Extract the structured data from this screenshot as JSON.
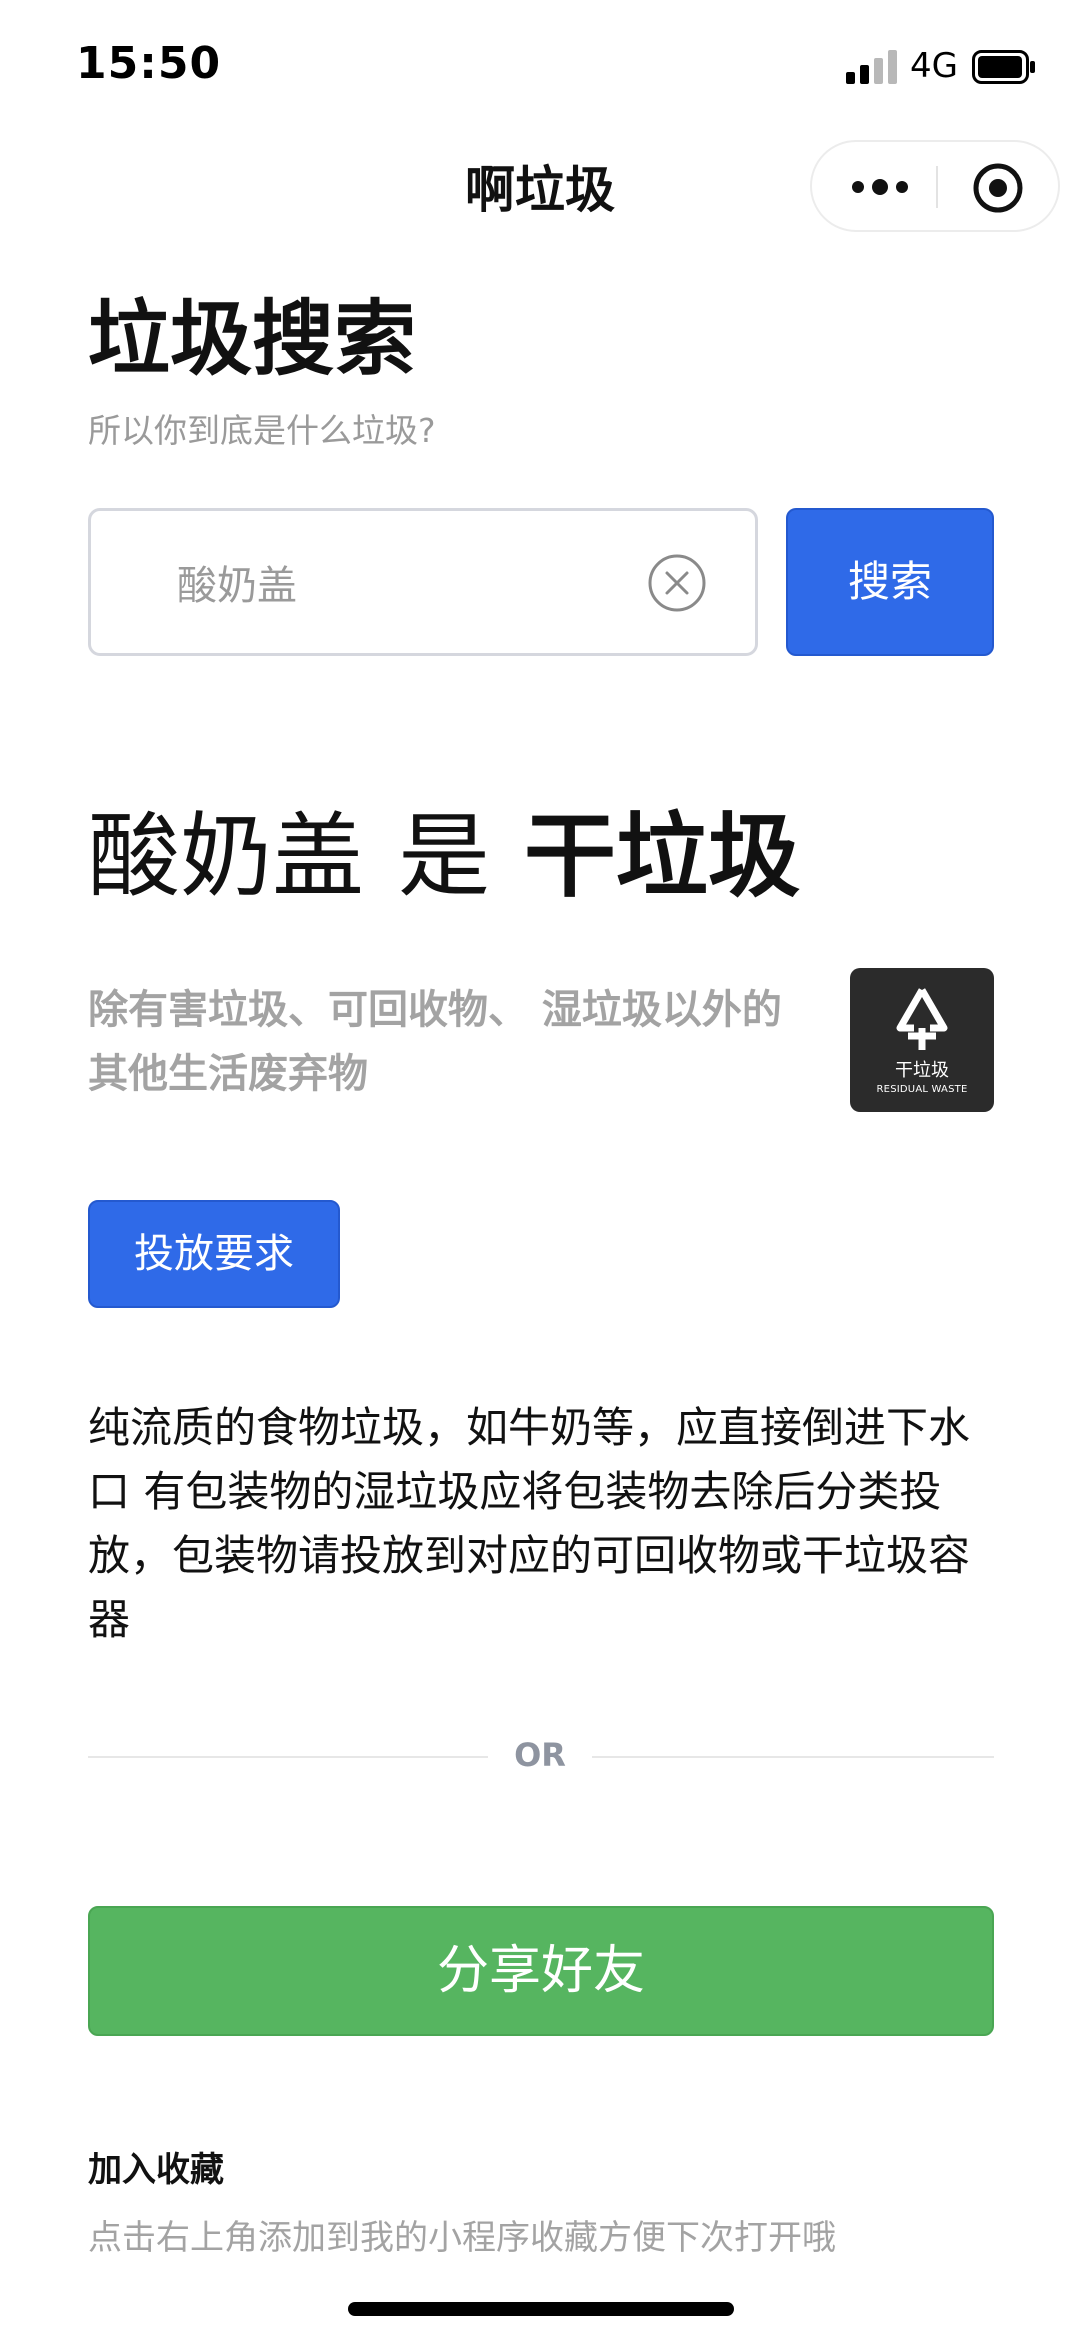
{
  "status_bar": {
    "time": "15:50",
    "network": "4G",
    "signal_icon": "signal-bars-icon",
    "battery_icon": "battery-icon"
  },
  "nav": {
    "title": "啊垃圾",
    "more_icon": "more-dots-icon",
    "close_icon": "record-target-icon"
  },
  "header": {
    "title": "垃圾搜索",
    "subtitle": "所以你到底是什么垃圾?"
  },
  "search": {
    "value": "酸奶盖",
    "placeholder": "",
    "button_label": "搜索",
    "clear_icon": "clear-circle-icon"
  },
  "result": {
    "item": "酸奶盖",
    "verb": "是",
    "category": "干垃圾",
    "description": "除有害垃圾、可回收物、 湿垃圾以外的其他生活废弃物",
    "logo": {
      "cn_label": "干垃圾",
      "en_label": "RESIDUAL WASTE",
      "icon": "recycle-arrows-icon"
    }
  },
  "requirements": {
    "button_label": "投放要求",
    "text": "纯流质的食物垃圾，如牛奶等，应直接倒进下水口 有包装物的湿垃圾应将包装物去除后分类投放，包装物请投放到对应的可回收物或干垃圾容器"
  },
  "divider": {
    "label": "OR"
  },
  "share": {
    "button_label": "分享好友"
  },
  "favorites": {
    "title": "加入收藏",
    "hint": "点击右上角添加到我的小程序收藏方便下次打开哦"
  },
  "colors": {
    "primary_blue": "#2f6ae8",
    "share_green": "#56b560",
    "muted_text": "#a3a3a3",
    "logo_dark": "#2b2b2b"
  }
}
